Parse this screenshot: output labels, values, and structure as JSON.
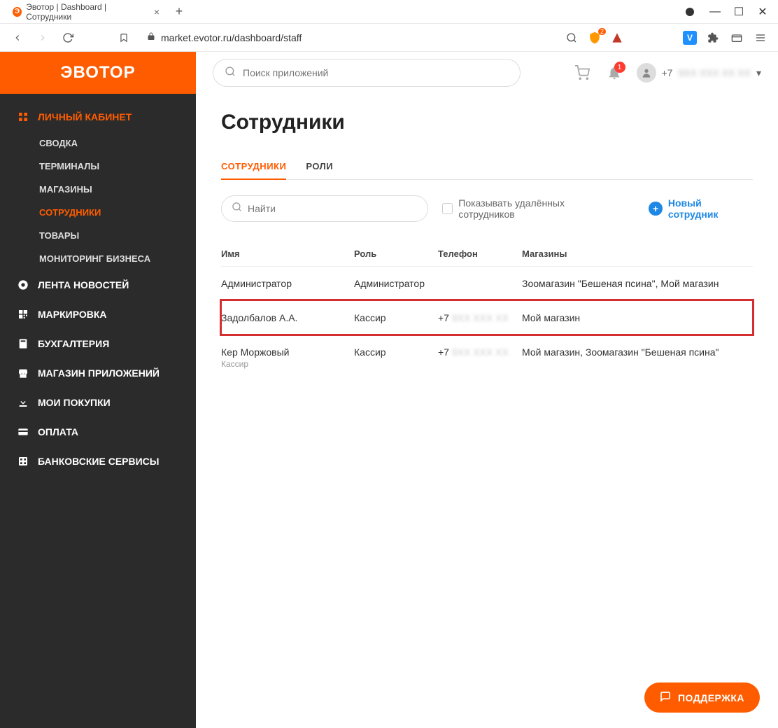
{
  "browser": {
    "tab_title": "Эвотор | Dashboard | Сотрудники",
    "url": "market.evotor.ru/dashboard/staff",
    "shield_badge": "2"
  },
  "logo": "ЭВОТОР",
  "sidebar": {
    "main": "ЛИЧНЫЙ КАБИНЕТ",
    "sub": [
      "СВОДКА",
      "ТЕРМИНАЛЫ",
      "МАГАЗИНЫ",
      "СОТРУДНИКИ",
      "ТОВАРЫ",
      "МОНИТОРИНГ БИЗНЕСА"
    ],
    "items": [
      "ЛЕНТА НОВОСТЕЙ",
      "МАРКИРОВКА",
      "БУХГАЛТЕРИЯ",
      "МАГАЗИН ПРИЛОЖЕНИЙ",
      "МОИ ПОКУПКИ",
      "ОПЛАТА",
      "БАНКОВСКИЕ СЕРВИСЫ"
    ]
  },
  "topbar": {
    "search_placeholder": "Поиск приложений",
    "notif_count": "1",
    "user_prefix": "+7"
  },
  "page": {
    "title": "Сотрудники",
    "tabs": [
      "СОТРУДНИКИ",
      "РОЛИ"
    ],
    "search_placeholder": "Найти",
    "show_deleted_label": "Показывать удалённых сотрудников",
    "add_label": "Новый сотрудник"
  },
  "table": {
    "headers": {
      "name": "Имя",
      "role": "Роль",
      "phone": "Телефон",
      "shops": "Магазины"
    },
    "rows": [
      {
        "name": "Администратор",
        "sub_role": "",
        "role": "Администратор",
        "phone_prefix": "",
        "shops": "Зоомагазин \"Бешеная псина\", Мой магазин",
        "highlight": false
      },
      {
        "name": "Задолбалов А.А.",
        "sub_role": "",
        "role": "Кассир",
        "phone_prefix": "+7",
        "shops": "Мой магазин",
        "highlight": true
      },
      {
        "name": "Кер Моржовый",
        "sub_role": "Кассир",
        "role": "Кассир",
        "phone_prefix": "+7",
        "shops": "Мой магазин, Зоомагазин \"Бешеная псина\"",
        "highlight": false
      }
    ]
  },
  "support_label": "ПОДДЕРЖКА"
}
